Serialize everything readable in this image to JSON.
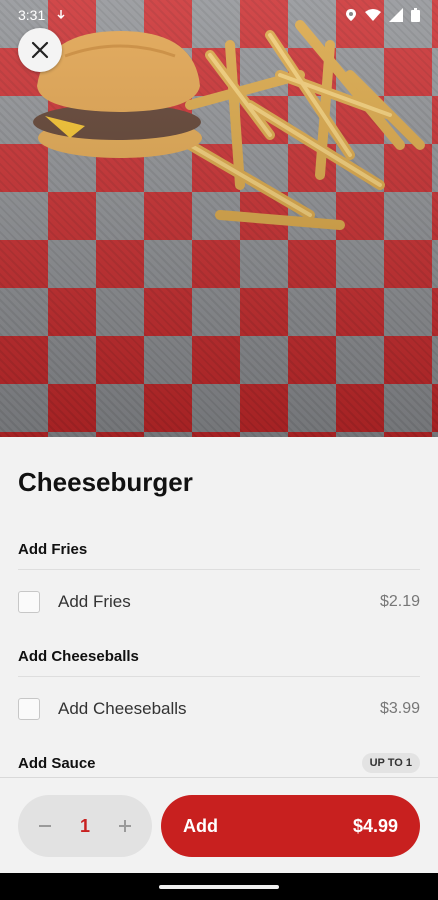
{
  "status_bar": {
    "time": "3:31"
  },
  "item": {
    "title": "Cheeseburger"
  },
  "sections": [
    {
      "heading": "Add Fries",
      "option": {
        "label": "Add Fries",
        "price": "$2.19"
      }
    },
    {
      "heading": "Add Cheeseballs",
      "option": {
        "label": "Add Cheeseballs",
        "price": "$3.99"
      }
    },
    {
      "heading": "Add Sauce",
      "badge": "UP TO 1"
    }
  ],
  "footer": {
    "quantity": "1",
    "minus_icon": "minus-icon",
    "plus_icon": "plus-icon",
    "add_label": "Add",
    "add_price": "$4.99"
  },
  "colors": {
    "accent": "#c8201f",
    "sheet_bg": "#f2f2f2"
  }
}
